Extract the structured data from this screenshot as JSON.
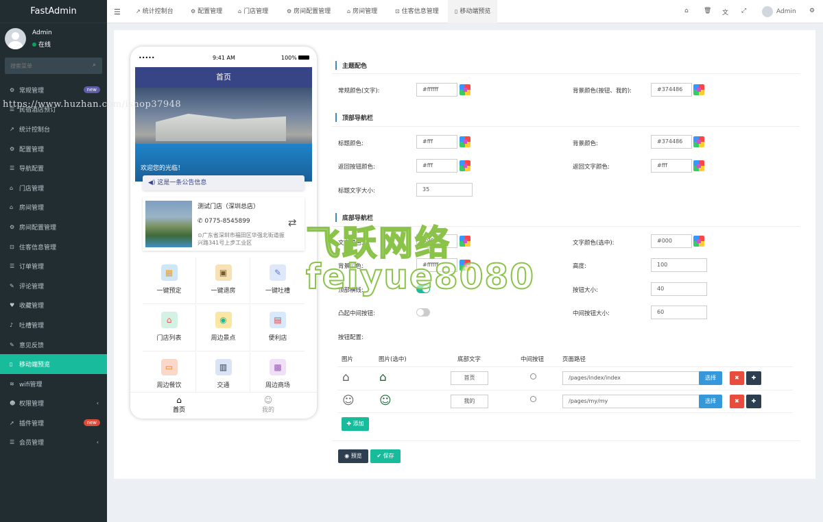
{
  "sidebar": {
    "brand": "FastAdmin",
    "user_name": "Admin",
    "user_status": "在线",
    "search_placeholder": "搜索菜单",
    "items": [
      {
        "label": "常规管理",
        "icon": "cogs-icon",
        "badge": "new"
      },
      {
        "label": "民宿酒店预订"
      },
      {
        "label": "统计控制台",
        "icon": "chart-icon"
      },
      {
        "label": "配置管理",
        "icon": "gear-icon"
      },
      {
        "label": "导航配置",
        "icon": "list-icon"
      },
      {
        "label": "门店管理",
        "icon": "bank-icon"
      },
      {
        "label": "房间管理",
        "icon": "home-icon"
      },
      {
        "label": "房间配置管理",
        "icon": "gear-icon"
      },
      {
        "label": "住客信息管理",
        "icon": "lock-icon"
      },
      {
        "label": "订单管理",
        "icon": "list-icon"
      },
      {
        "label": "评论管理",
        "icon": "comment-icon"
      },
      {
        "label": "收藏管理",
        "icon": "heart-icon"
      },
      {
        "label": "吐槽管理",
        "icon": "mic-icon"
      },
      {
        "label": "意见反馈",
        "icon": "pencil-icon"
      },
      {
        "label": "移动端预览",
        "icon": "mobile-icon"
      },
      {
        "label": "wifi管理",
        "icon": "wifi-icon"
      },
      {
        "label": "权限管理",
        "icon": "users-icon"
      },
      {
        "label": "插件管理",
        "icon": "rocket-icon",
        "badge": "new"
      },
      {
        "label": "会员管理",
        "icon": "list-icon"
      }
    ],
    "watermark": "https://www.huzhan.com/ishop37948"
  },
  "topnav": {
    "tabs": [
      "统计控制台",
      "配置管理",
      "门店管理",
      "房间配置管理",
      "房间管理",
      "住客信息管理",
      "移动端预览"
    ],
    "admin_label": "Admin"
  },
  "phone": {
    "signal": "•••••",
    "time": "9:41 AM",
    "battery": "100%",
    "header_title": "首页",
    "banner_text": "欢迎您的光临！",
    "notice": "这是一条公告信息",
    "store_name": "测试门店（深圳总店）",
    "store_phone": "0775-8545899",
    "store_address": "广东省深圳市福田区华强北街道振兴路341号上步工业区",
    "grid": [
      "一键预定",
      "一键退房",
      "一键吐槽",
      "门店列表",
      "周边景点",
      "便利店",
      "周边餐饮",
      "交通",
      "周边商场"
    ],
    "tabbar": [
      "首页",
      "我的"
    ]
  },
  "form": {
    "theme_title": "主题配色",
    "normal_color_label": "常规颜色(文字):",
    "normal_color_value": "#ffffff",
    "bg_color_label": "背景颜色(按钮、我的):",
    "bg_color_value": "#374486",
    "topnav_title": "顶部导航栏",
    "title_color_label": "标题颜色:",
    "title_color_value": "#fff",
    "top_bg_label": "背景颜色:",
    "top_bg_value": "#374486",
    "back_btn_label": "返回按钮颜色:",
    "back_btn_value": "#fff",
    "back_text_label": "返回文字颜色:",
    "back_text_value": "#fff",
    "title_size_label": "标题文字大小:",
    "title_size_value": "35",
    "bottom_title": "底部导航栏",
    "text_color_label": "文字颜色:",
    "text_color_value": "#999",
    "text_sel_label": "文字颜色(选中):",
    "text_sel_value": "#000",
    "bottom_bg_label": "背景颜色:",
    "bottom_bg_value": "#ffffff",
    "height_label": "高度:",
    "height_value": "100",
    "top_line_label": "顶部横线:",
    "btn_size_label": "按钮大小:",
    "btn_size_value": "40",
    "raised_label": "凸起中间按钮:",
    "mid_size_label": "中间按钮大小:",
    "mid_size_value": "60",
    "btn_config_label": "按钮配置:",
    "table_headers": [
      "图片",
      "图片(选中)",
      "底部文字",
      "中间按钮",
      "页面路径"
    ],
    "rows": [
      {
        "text": "首页",
        "path": "/pages/index/index",
        "select": "选择"
      },
      {
        "text": "我的",
        "path": "/pages/my/my",
        "select": "选择"
      }
    ],
    "add_label": "添加",
    "preview_label": "预览",
    "save_label": "保存"
  },
  "watermark": {
    "line1": "飞跃网络",
    "line2": "feiyue8080"
  },
  "colors": {
    "accent": "#18bc9c",
    "brand": "#374486",
    "sidebar": "#222d32",
    "danger": "#e74c3c",
    "dark": "#2c3e50",
    "info": "#3498db"
  }
}
